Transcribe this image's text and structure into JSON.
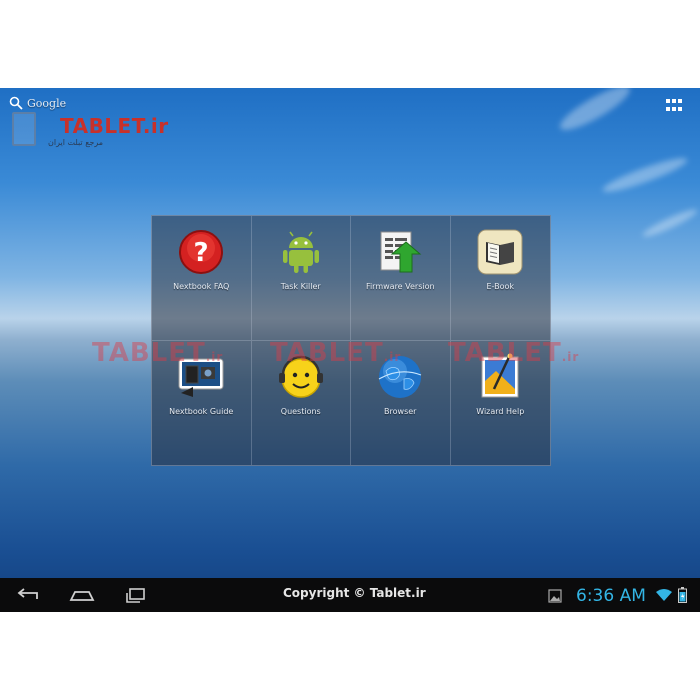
{
  "header": {
    "google_label": "Google",
    "brand_name": "TABLET.ir",
    "brand_subtitle": "مرجع تبلت ایران"
  },
  "apps": [
    {
      "label": "Nextbook FAQ",
      "icon": "help-icon"
    },
    {
      "label": "Task Killer",
      "icon": "android-icon"
    },
    {
      "label": "Firmware Version",
      "icon": "firmware-update-icon"
    },
    {
      "label": "E-Book",
      "icon": "book-icon"
    },
    {
      "label": "Nextbook Guide",
      "icon": "guide-icon"
    },
    {
      "label": "Questions",
      "icon": "smiley-headset-icon"
    },
    {
      "label": "Browser",
      "icon": "globe-icon"
    },
    {
      "label": "Wizard Help",
      "icon": "wizard-icon"
    }
  ],
  "watermark": {
    "text": "TABLET",
    "suffix": ".ir"
  },
  "statusbar": {
    "copyright": "Copyright © Tablet.ir",
    "time": "6:36 AM"
  },
  "colors": {
    "clock": "#33b5e5",
    "brand": "#c8312a",
    "navbar": "#0b0b0c"
  }
}
